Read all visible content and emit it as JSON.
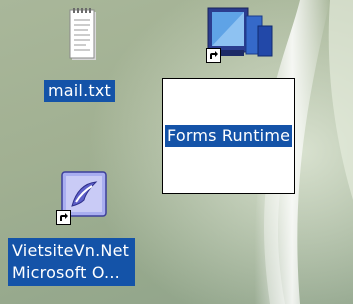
{
  "desktop": {
    "icons": [
      {
        "label": "mail.txt",
        "icon": "text-file-icon"
      },
      {
        "label": "Forms Runtime",
        "icon": "forms-runtime-icon",
        "shortcut": true,
        "renaming": true
      },
      {
        "label": "VietsiteVn.Net\nMicrosoft O...",
        "icon": "office-shortcut-icon",
        "shortcut": true
      }
    ]
  },
  "colors": {
    "selection": "#1453a8",
    "wallpaper": "#a3b295",
    "label_text": "#ffffff"
  }
}
